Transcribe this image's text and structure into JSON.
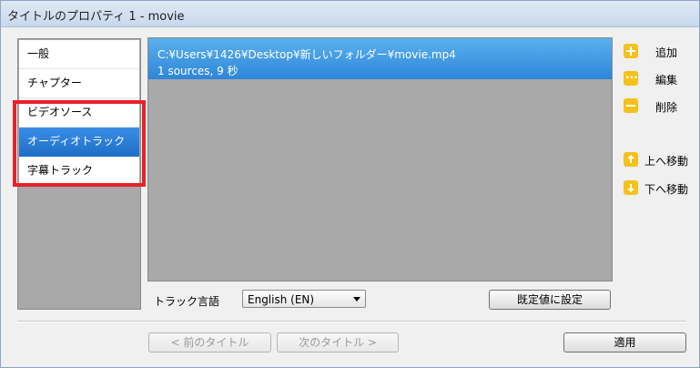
{
  "window": {
    "title": "タイトルのプロパティ 1 - movie"
  },
  "categories": [
    {
      "label": "一般",
      "selected": false
    },
    {
      "label": "チャプター",
      "selected": false
    },
    {
      "label": "ビデオソース",
      "selected": false
    },
    {
      "label": "オーディオトラック",
      "selected": true
    },
    {
      "label": "字幕トラック",
      "selected": false
    }
  ],
  "sources": [
    {
      "path": "C:¥Users¥1426¥Desktop¥新しいフォルダー¥movie.mp4",
      "info": "1 sources, 9 秒"
    }
  ],
  "actions": {
    "add": "追加",
    "edit": "編集",
    "delete": "削除",
    "move_up": "上へ移動",
    "move_down": "下へ移動"
  },
  "track_language": {
    "label": "トラック言語",
    "value": "English (EN)"
  },
  "buttons": {
    "set_default": "既定値に設定",
    "prev_title": "< 前のタイトル",
    "next_title": "次のタイトル >",
    "apply": "適用"
  },
  "colors": {
    "selection": "#2f86d8",
    "highlight": "#e8202a",
    "action_icon": "#f5c11b"
  }
}
